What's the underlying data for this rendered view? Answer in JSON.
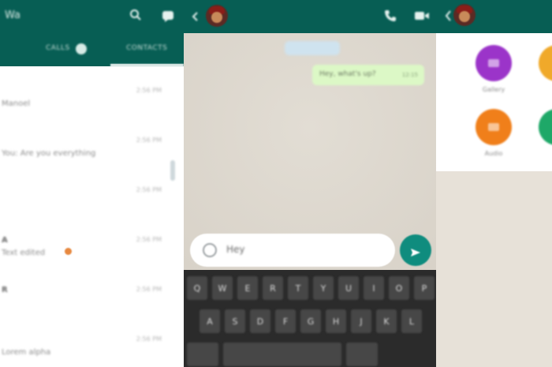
{
  "chat_list": {
    "title": "Wa",
    "tabs": [
      {
        "label": "CALLS"
      },
      {
        "label": "CONTACTS"
      }
    ],
    "rows": [
      {
        "mark": "",
        "title": "Manoel",
        "time": "2:56 PM"
      },
      {
        "mark": "",
        "title": "You: Are you everything",
        "time": "2:56 PM"
      },
      {
        "mark": "",
        "title": "",
        "time": "2:56 PM"
      },
      {
        "mark": "A",
        "title": "Text edited",
        "time": "2:56 PM"
      },
      {
        "mark": "R",
        "title": "",
        "time": "2:56 PM"
      },
      {
        "mark": "",
        "title": "Lorem alpha",
        "time": "2:56 PM"
      }
    ]
  },
  "conversation": {
    "date_chip": "",
    "message": {
      "text": "Hey, what's up?",
      "time": "12:15"
    },
    "input_value": "Hey",
    "keyboard": {
      "row1": [
        "Q",
        "W",
        "E",
        "R",
        "T",
        "Y",
        "U",
        "I",
        "O",
        "P"
      ],
      "row2": [
        "A",
        "S",
        "D",
        "F",
        "G",
        "H",
        "J",
        "K",
        "L"
      ]
    }
  },
  "attach": {
    "items": [
      {
        "label": "Gallery",
        "color": "#9b34c9"
      },
      {
        "label": "Audio",
        "color": "#f07f1a"
      },
      {
        "label": "",
        "color": "#f0a92a"
      },
      {
        "label": "",
        "color": "#1ea868"
      }
    ]
  },
  "colors": {
    "primary": "#075e54",
    "accent": "#0f8c7e",
    "bubble": "#dcf8c6"
  }
}
